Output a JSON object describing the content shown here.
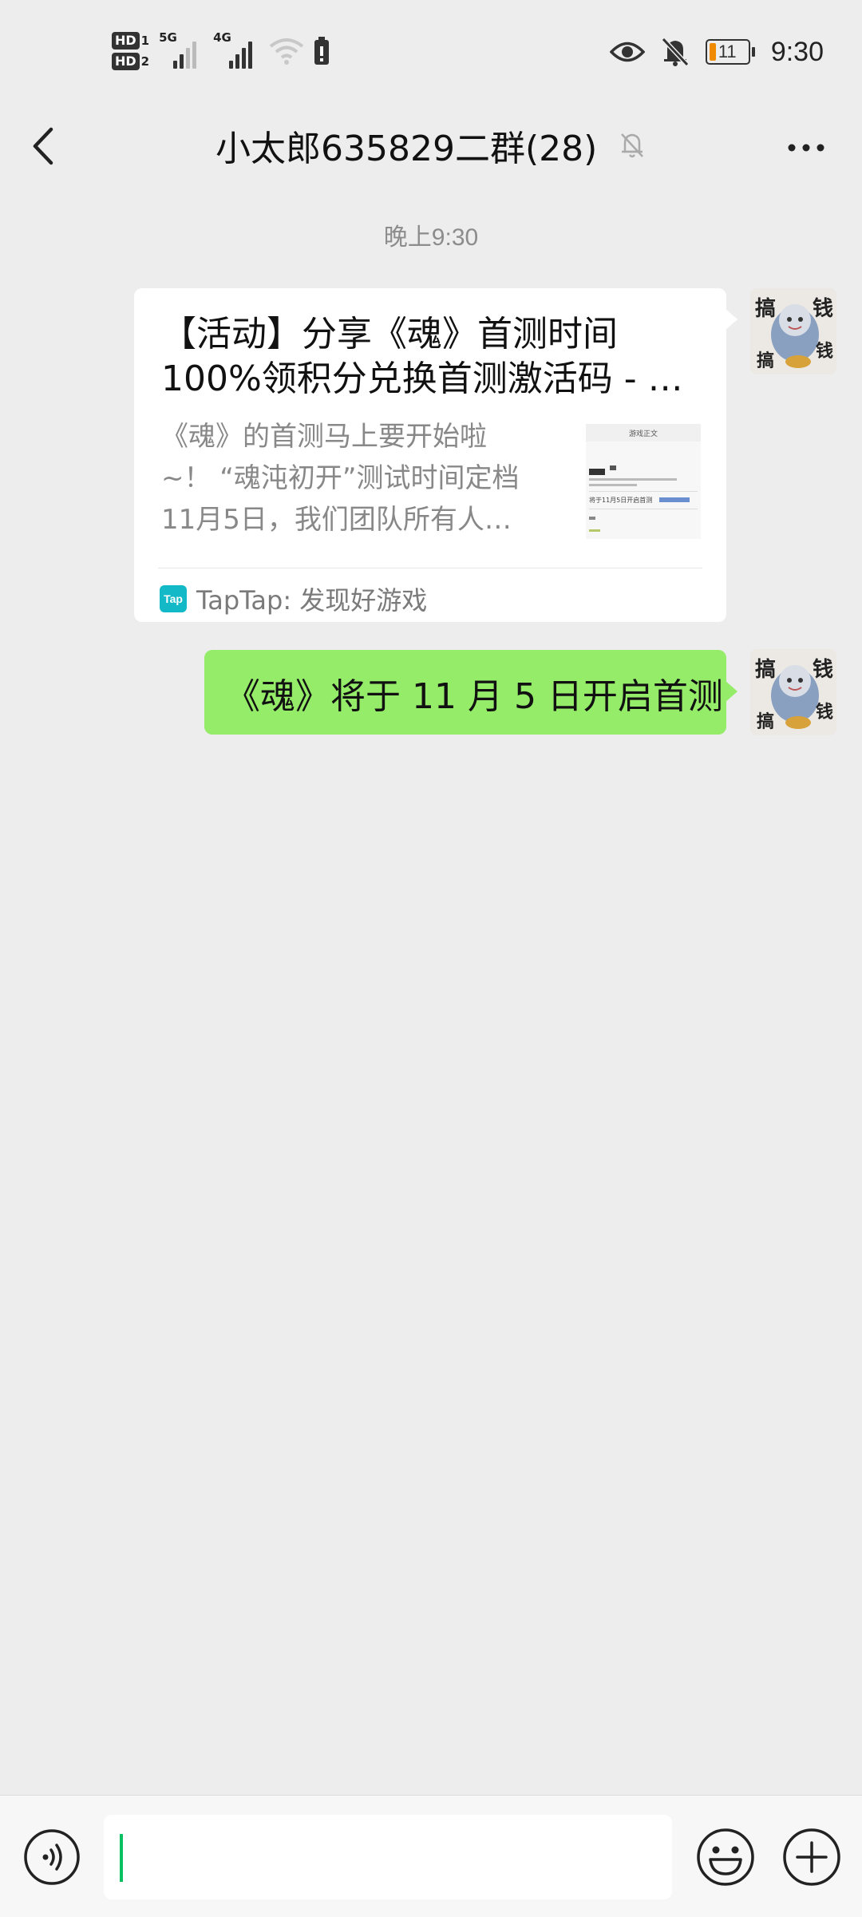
{
  "status_bar": {
    "hd1": "HD",
    "hd1_sub": "1",
    "hd2": "HD",
    "hd2_sub": "2",
    "net1": "5G",
    "net2": "4G",
    "time": "9:30",
    "battery": "11"
  },
  "header": {
    "title": "小太郎635829二群(28)"
  },
  "chat": {
    "timestamp": "晚上9:30",
    "card": {
      "title_line1": "【活动】分享《魂》首测时间",
      "title_line2": "100%领积分兑换首测激活码 - …",
      "desc_line1": "《魂》的首测马上要开始啦",
      "desc_line2": "~！ “魂沌初开”测试时间定档",
      "desc_line3": "11月5日，我们团队所有人…",
      "thumb_title": "游戏正文",
      "thumb_line": "将于11月5日开启首测",
      "source_logo": "Tap",
      "source": "TapTap: 发现好游戏"
    },
    "message": "《魂》将于 11 月 5 日开启首测",
    "avatar_chars": [
      "搞",
      "钱"
    ]
  },
  "colors": {
    "background": "#ededed",
    "bubble_green": "#95ec69",
    "accent_green": "#07c160",
    "taptap": "#14b9c8"
  }
}
